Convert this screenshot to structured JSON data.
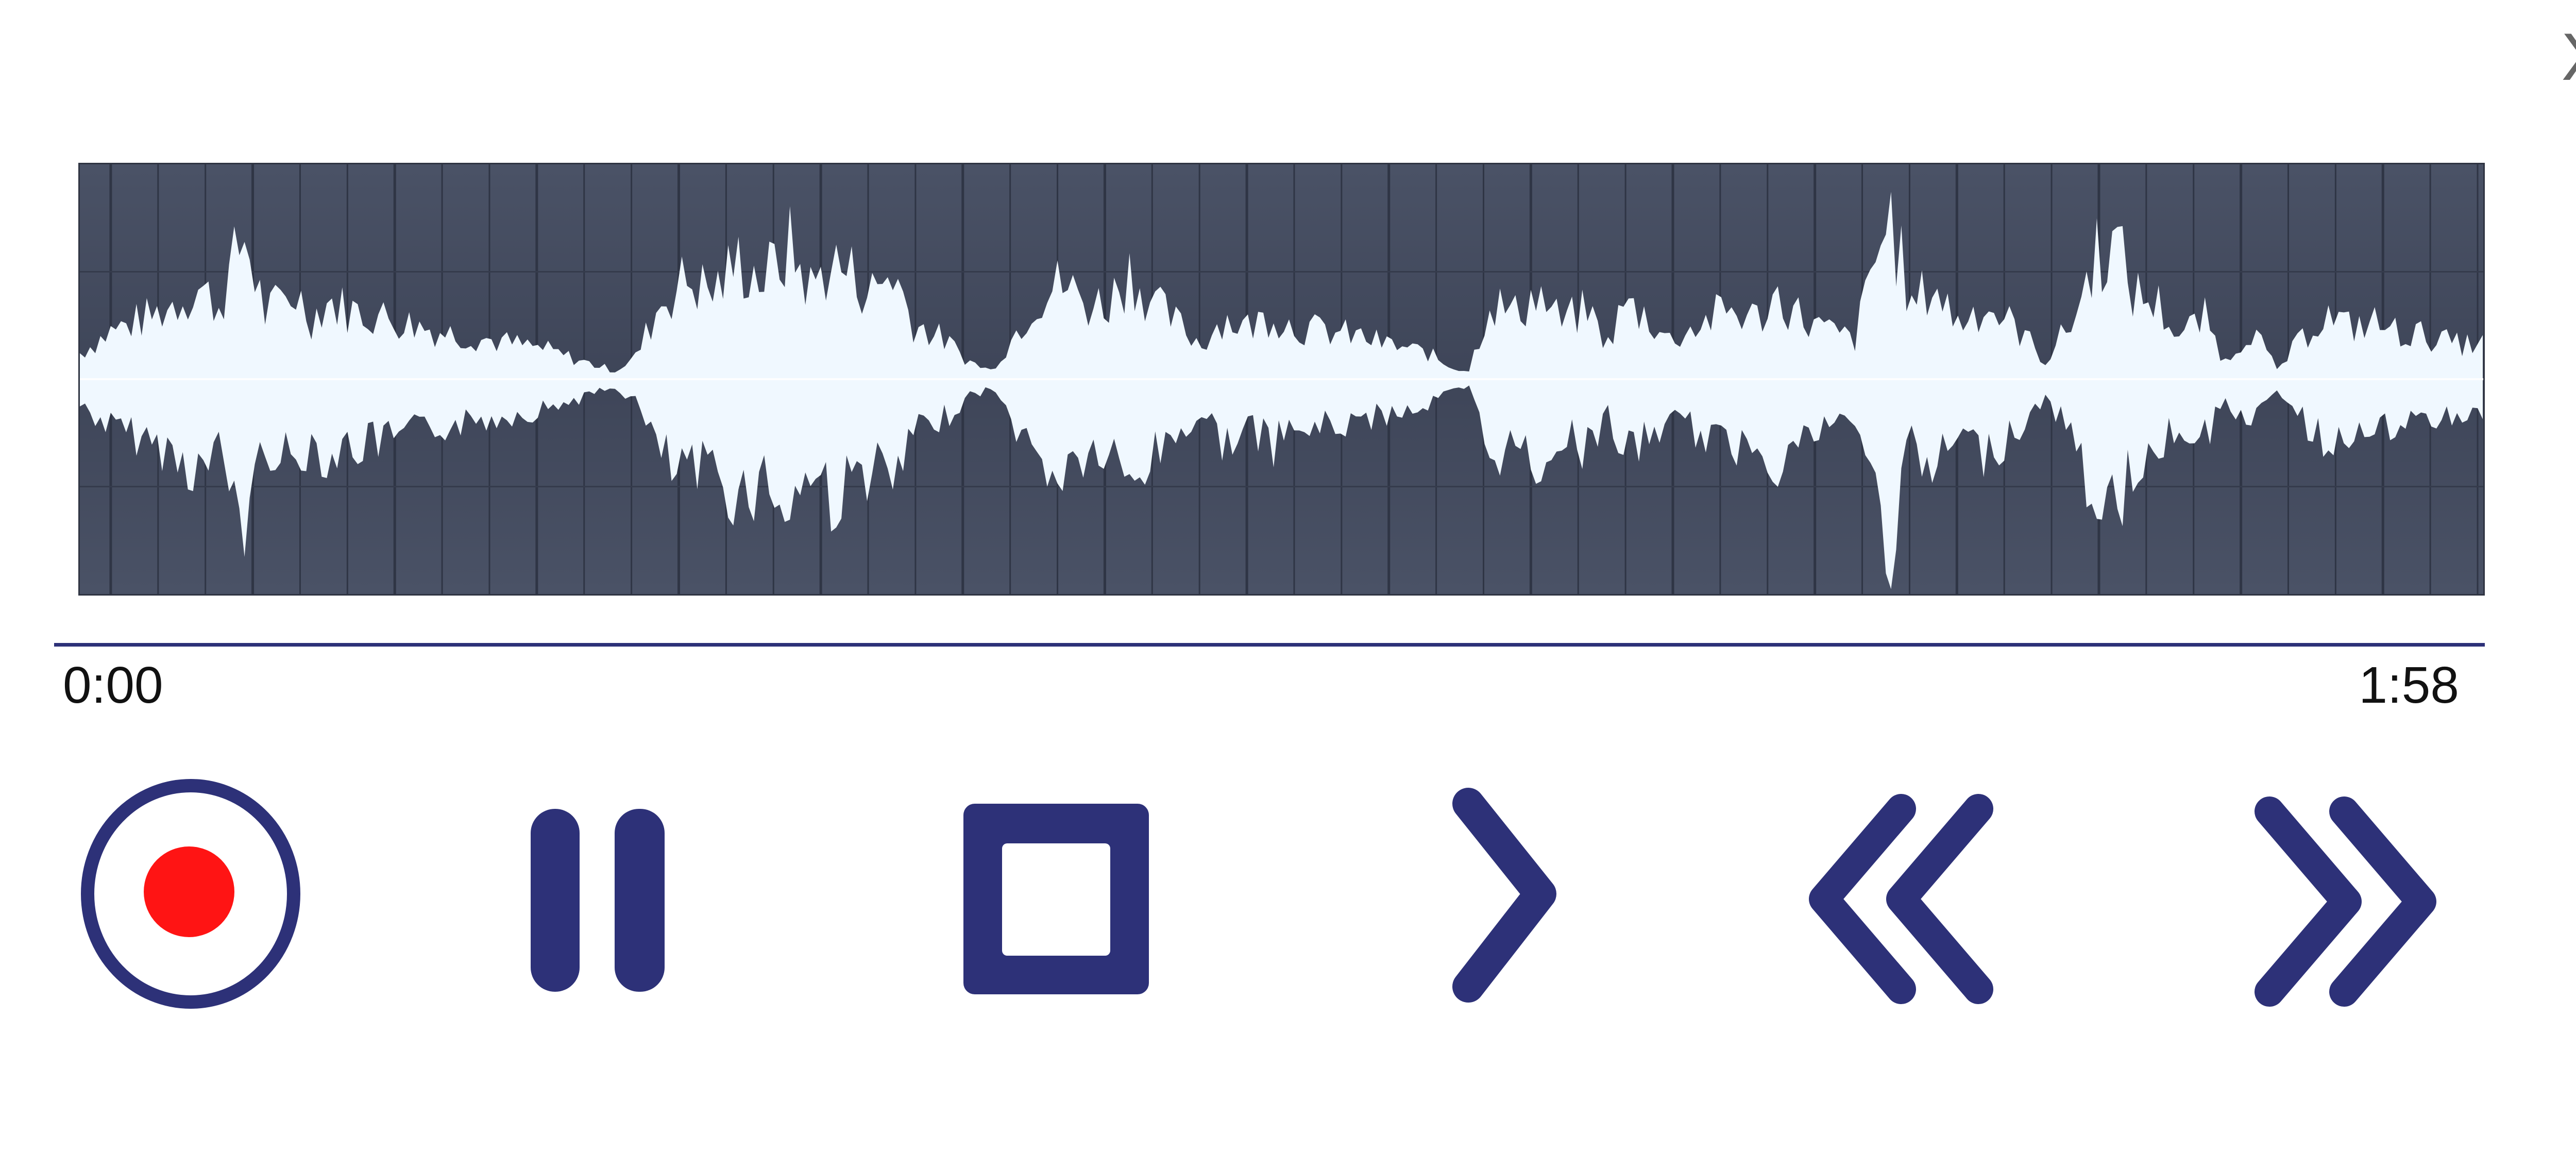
{
  "window": {
    "close_label": "X"
  },
  "player": {
    "current_time": "0:00",
    "total_time": "1:58",
    "progress": 0.0
  },
  "controls": {
    "record": {
      "icon": "record-icon"
    },
    "pause": {
      "icon": "pause-icon"
    },
    "stop": {
      "icon": "stop-icon"
    },
    "play": {
      "icon": "play-icon"
    },
    "rewind": {
      "icon": "rewind-icon"
    },
    "fast_forward": {
      "icon": "fast-forward-icon"
    }
  },
  "colors": {
    "control_navy": "#2d3178",
    "record_red": "#ff1414",
    "waveform_bg": "#434a5e",
    "waveform_fg": "#f0f8ff",
    "close_grey": "#666666"
  }
}
